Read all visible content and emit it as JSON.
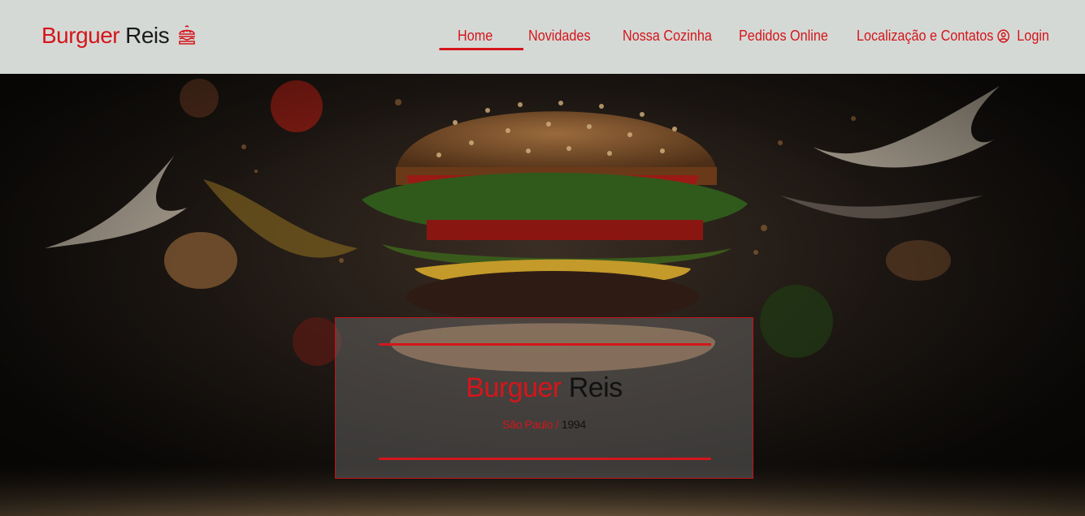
{
  "brand": {
    "name_part1": "Burguer",
    "name_part2": "Reis",
    "icon": "burger-icon"
  },
  "nav": {
    "items": [
      {
        "label": "Home",
        "active": true
      },
      {
        "label": "Novidades"
      },
      {
        "label": "Nossa Cozinha"
      },
      {
        "label": "Pedidos Online"
      },
      {
        "label": "Localização e Contatos"
      }
    ],
    "login_label": "Login",
    "login_icon": "user-circle-icon"
  },
  "hero": {
    "title_part1": "Burguer",
    "title_part2": "Reis",
    "subtitle_part1": "São Paulo /",
    "subtitle_part2": "1994"
  },
  "colors": {
    "accent": "#d4161b",
    "navbar_bg": "#d5d9d6",
    "text_dark": "#1a1a1a"
  }
}
